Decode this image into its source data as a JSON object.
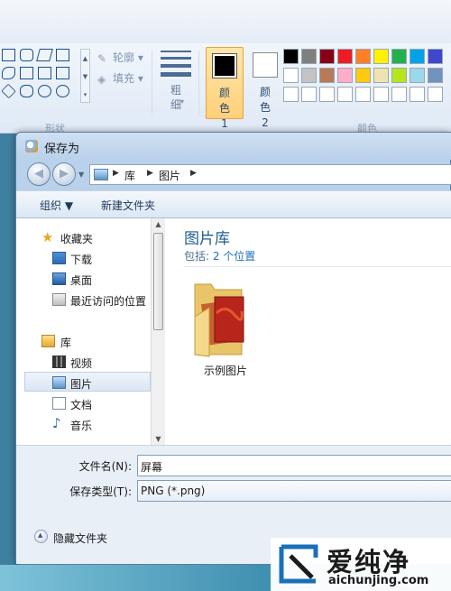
{
  "ribbon": {
    "shapes_group_label": "形状",
    "outline_label": "轮廓",
    "fill_label": "填充",
    "size_label": "粗细",
    "color1_label": "颜色 1",
    "color2_label": "颜色 2",
    "colors_group_label": "颜色",
    "color1_value": "#000000",
    "color2_value": "#ffffff",
    "palette_row1": [
      "#000000",
      "#7f7f7f",
      "#880015",
      "#ed1c24",
      "#ff7f27",
      "#fff200",
      "#22b14c",
      "#00a2e8",
      "#3f48cc"
    ],
    "palette_row2": [
      "#ffffff",
      "#c3c3c3",
      "#b97a57",
      "#ffaec9",
      "#ffc90e",
      "#efe4b0",
      "#b5e61d",
      "#99d9ea",
      "#7092be"
    ],
    "palette_row3": [
      "#ffffff",
      "#ffffff",
      "#ffffff",
      "#ffffff",
      "#ffffff",
      "#ffffff",
      "#ffffff",
      "#ffffff",
      "#ffffff"
    ]
  },
  "dialog": {
    "title": "保存为",
    "breadcrumb": [
      "库",
      "图片"
    ],
    "toolbar": {
      "organize_label": "组织 ▼",
      "new_folder_label": "新建文件夹"
    },
    "navpane": {
      "favorites_label": "收藏夹",
      "favorites_items": [
        "下载",
        "桌面",
        "最近访问的位置"
      ],
      "libraries_label": "库",
      "libraries_items": [
        "视频",
        "图片",
        "文档",
        "音乐"
      ],
      "selected": "图片"
    },
    "library": {
      "title": "图片库",
      "includes_prefix": "包括: ",
      "includes_link": "2 个位置",
      "folder_name": "示例图片"
    },
    "filename_label": "文件名(N):",
    "filename_value": "屏幕",
    "filetype_label": "保存类型(T):",
    "filetype_value": "PNG (*.png)",
    "hide_folders_label": "隐藏文件夹"
  },
  "watermark": {
    "title": "爱纯净",
    "url": "aichunjing.com"
  },
  "icons": {
    "star": "star-icon",
    "folder": "folder-icon",
    "back": "back-arrow-icon",
    "forward": "forward-arrow-icon"
  }
}
